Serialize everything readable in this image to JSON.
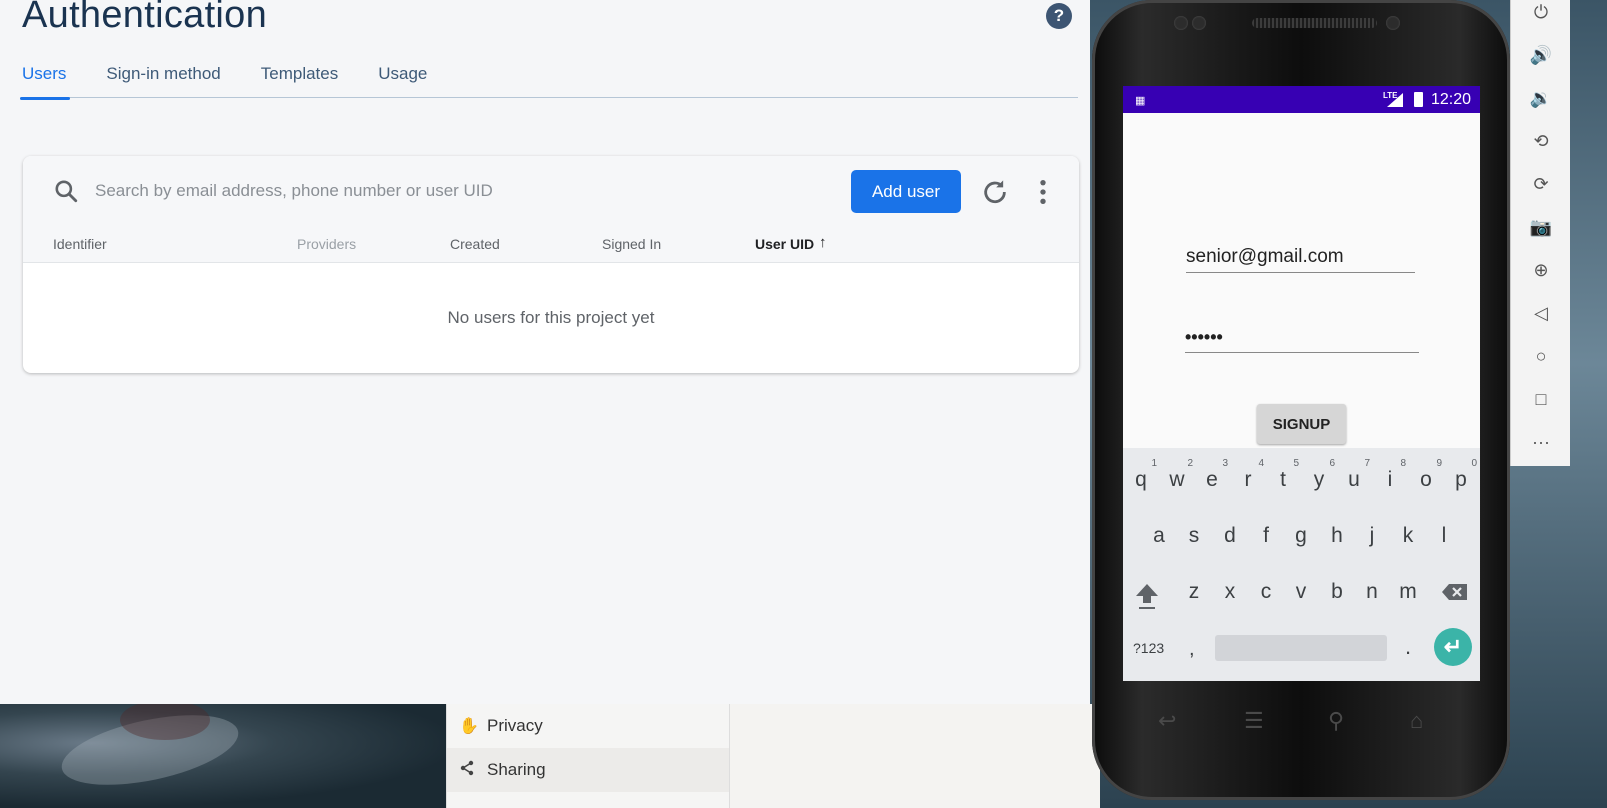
{
  "page": {
    "title": "Authentication",
    "tabs": [
      {
        "label": "Users",
        "active": true
      },
      {
        "label": "Sign-in method",
        "active": false
      },
      {
        "label": "Templates",
        "active": false
      },
      {
        "label": "Usage",
        "active": false
      }
    ]
  },
  "users_card": {
    "search_placeholder": "Search by email address, phone number or user UID",
    "add_user_label": "Add user",
    "columns": [
      "Identifier",
      "Providers",
      "Created",
      "Signed In",
      "User UID"
    ],
    "empty_message": "No users for this project yet"
  },
  "context_menu": {
    "items": [
      {
        "label": "Privacy",
        "icon": "hand-icon"
      },
      {
        "label": "Sharing",
        "icon": "share-icon"
      }
    ]
  },
  "emulator": {
    "status_time": "12:20",
    "network": "LTE",
    "email_value": "senior@gmail.com",
    "password_value": "••••••",
    "signup_label": "SIGNUP",
    "keyboard": {
      "row1": [
        {
          "key": "q",
          "num": "1"
        },
        {
          "key": "w",
          "num": "2"
        },
        {
          "key": "e",
          "num": "3"
        },
        {
          "key": "r",
          "num": "4"
        },
        {
          "key": "t",
          "num": "5"
        },
        {
          "key": "y",
          "num": "6"
        },
        {
          "key": "u",
          "num": "7"
        },
        {
          "key": "i",
          "num": "8"
        },
        {
          "key": "o",
          "num": "9"
        },
        {
          "key": "p",
          "num": "0"
        }
      ],
      "row2": [
        "a",
        "s",
        "d",
        "f",
        "g",
        "h",
        "j",
        "k",
        "l"
      ],
      "row3": [
        "z",
        "x",
        "c",
        "v",
        "b",
        "n",
        "m"
      ],
      "symbols_label": "?123",
      "comma": ",",
      "period": "."
    }
  },
  "colors": {
    "accent": "#1a73e8",
    "status_bar": "#3700b3",
    "enter_key": "#3bb4a8"
  }
}
